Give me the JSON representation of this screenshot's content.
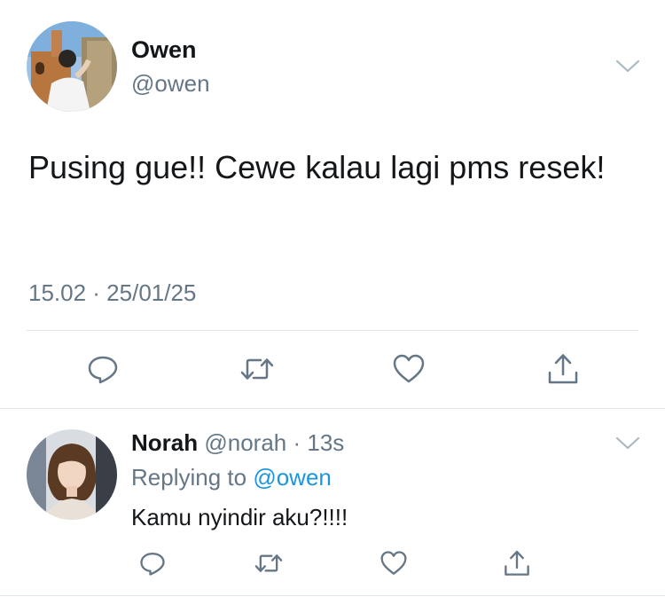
{
  "tweet": {
    "author_name": "Owen",
    "author_handle": "@owen",
    "text": "Pusing gue!! Cewe kalau lagi pms resek!",
    "timestamp": "15.02 · 25/01/25",
    "actions": [
      "reply-icon",
      "retweet-icon",
      "like-icon",
      "share-icon"
    ]
  },
  "reply": {
    "author_name": "Norah",
    "author_handle": "@norah",
    "separator": " · ",
    "time": "13s",
    "replying_label": "Replying to",
    "replying_to": "@owen",
    "text": "Kamu nyindir aku?!!!!",
    "actions": [
      "reply-icon",
      "retweet-icon",
      "like-icon",
      "share-icon"
    ]
  },
  "colors": {
    "text": "#14171a",
    "secondary": "#657786",
    "link": "#1b95e0",
    "divider": "#e1e8ed"
  }
}
